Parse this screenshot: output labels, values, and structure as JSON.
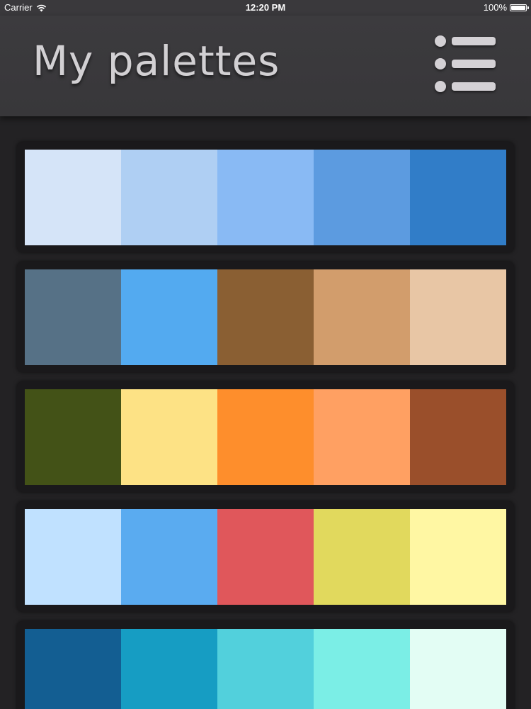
{
  "status_bar": {
    "carrier": "Carrier",
    "time": "12:20 PM",
    "battery": "100%",
    "battery_level": 1.0
  },
  "header": {
    "title": "My palettes",
    "menu_icon": "list-icon"
  },
  "palettes": [
    {
      "colors": [
        "#d5e4f8",
        "#afcff3",
        "#89baf4",
        "#5c9be0",
        "#317dc8"
      ]
    },
    {
      "colors": [
        "#567186",
        "#53aaf0",
        "#8a5f33",
        "#d29d6c",
        "#e8c6a5"
      ]
    },
    {
      "colors": [
        "#435217",
        "#fde285",
        "#fe8e2c",
        "#ffa062",
        "#9a4f2b"
      ]
    },
    {
      "colors": [
        "#c0e1ff",
        "#5aabf0",
        "#e0575b",
        "#e1d95d",
        "#fff7a3"
      ]
    },
    {
      "colors": [
        "#135e92",
        "#169dc3",
        "#52d0dc",
        "#7beee6",
        "#e3fdf4"
      ]
    }
  ]
}
